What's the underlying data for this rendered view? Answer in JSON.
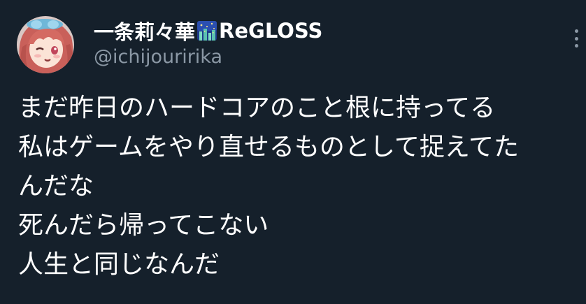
{
  "tweet": {
    "display_name": "一条莉々華",
    "emoji_icon": "starry-night-emoji",
    "group_name": "ReGLOSS",
    "handle": "@ichijouririka",
    "more_icon": "more-dots-icon",
    "body_lines": [
      "まだ昨日のハードコアのこと根に持ってる",
      "私はゲームをやり直せるものとして捉えてた",
      "んだな",
      "死んだら帰ってこない",
      "人生と同じなんだ"
    ]
  },
  "colors": {
    "background": "#15202b",
    "text_primary": "#ffffff",
    "text_secondary": "#8b98a5"
  }
}
